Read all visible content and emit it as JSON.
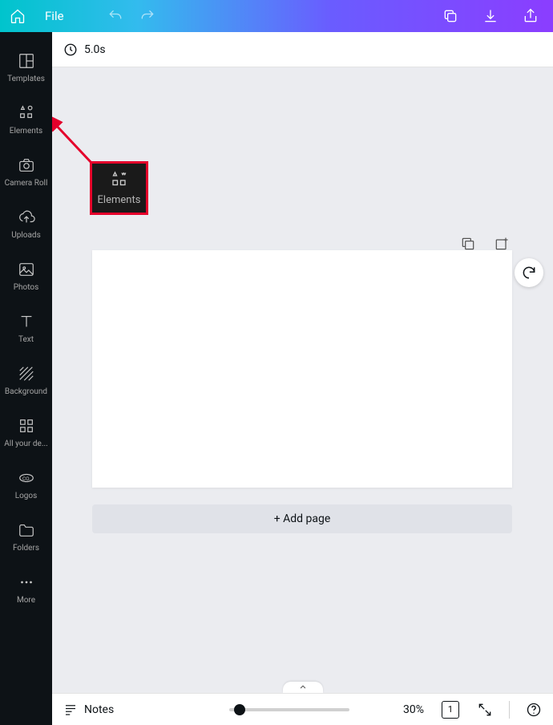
{
  "header": {
    "file_label": "File"
  },
  "sidebar": {
    "items": [
      {
        "label": "Templates"
      },
      {
        "label": "Elements"
      },
      {
        "label": "Camera Roll"
      },
      {
        "label": "Uploads"
      },
      {
        "label": "Photos"
      },
      {
        "label": "Text"
      },
      {
        "label": "Background"
      },
      {
        "label": "All your de..."
      },
      {
        "label": "Logos"
      },
      {
        "label": "Folders"
      },
      {
        "label": "More"
      }
    ]
  },
  "timebar": {
    "duration": "5.0s"
  },
  "canvas": {
    "add_page_label": "+ Add page"
  },
  "callout": {
    "label": "Elements"
  },
  "footer": {
    "notes_label": "Notes",
    "zoom_label": "30%",
    "page_number": "1"
  }
}
